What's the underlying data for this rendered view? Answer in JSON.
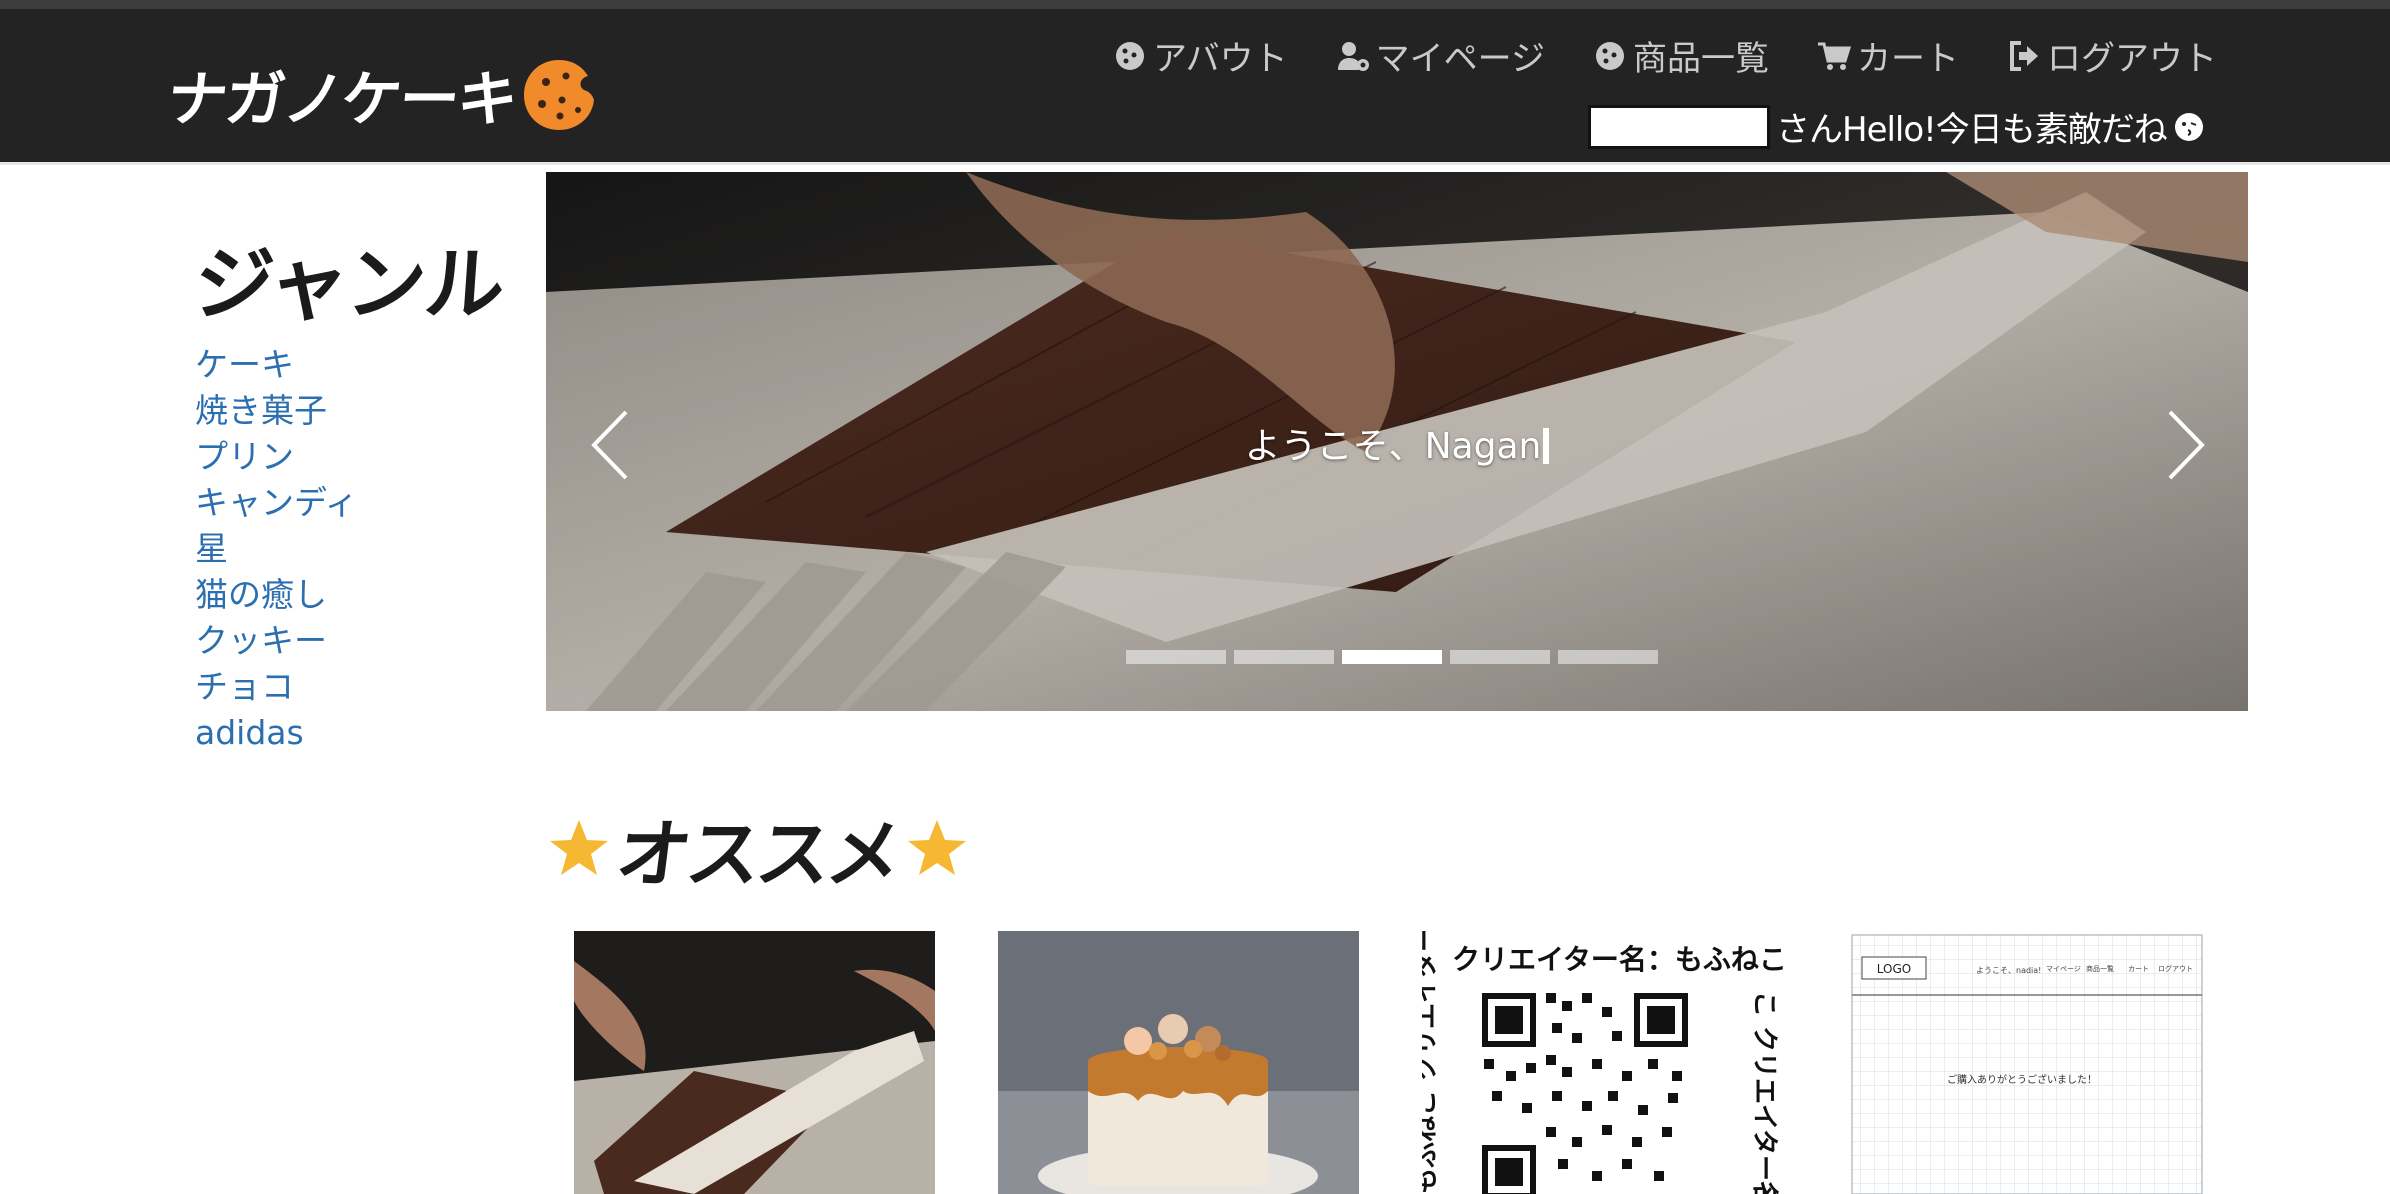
{
  "header": {
    "logo_text": "ナガノケーキ",
    "nav": [
      {
        "label": "アバウト",
        "icon": "cookie-icon"
      },
      {
        "label": "マイページ",
        "icon": "user-cog-icon"
      },
      {
        "label": "商品一覧",
        "icon": "cookie-icon"
      },
      {
        "label": "カート",
        "icon": "cart-icon"
      },
      {
        "label": "ログアウト",
        "icon": "logout-icon"
      }
    ],
    "greeting": "さんHello!今日も素敵だね"
  },
  "sidebar": {
    "title": "ジャンル",
    "genres": [
      "ケーキ",
      "焼き菓子",
      "プリン",
      "キャンディ",
      "星",
      "猫の癒し",
      "クッキー",
      "チョコ",
      "adidas"
    ]
  },
  "carousel": {
    "caption": "ようこそ、Nagan",
    "slide_count": 5,
    "active_slide": 3
  },
  "recommend": {
    "title": "オススメ"
  },
  "products": {
    "qr_card": {
      "top_text": "クリエイター名：もふねこ",
      "side_left": "もふねこ クリエイター",
      "side_right": "こ クリエイター名"
    },
    "wireframe_card": {
      "logo": "LOGO",
      "nav": [
        "ようこそ、nadia!",
        "マイページ",
        "商品一覧",
        "カート",
        "ログアウト"
      ],
      "message": "ご購入ありがとうございました！"
    }
  },
  "colors": {
    "header_bg": "#232323",
    "link": "#2c6fb0",
    "star": "#f6b733",
    "cookie": "#f08a2b"
  }
}
